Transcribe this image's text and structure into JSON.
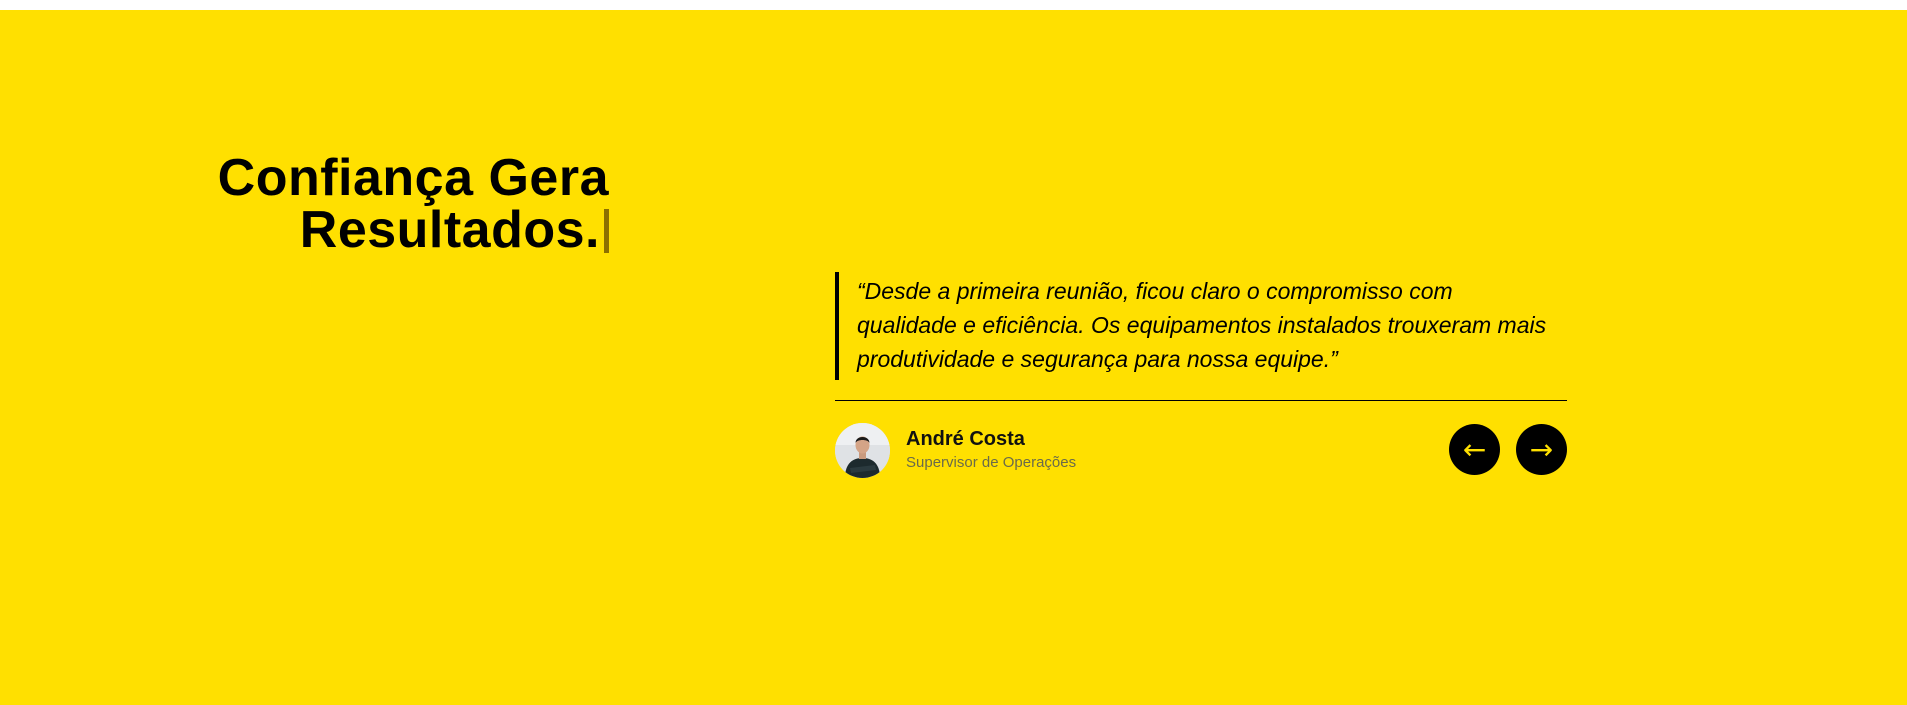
{
  "section": {
    "background_color": "#ffe000",
    "accent_text_color": "#000000"
  },
  "heading": {
    "line1": "Confiança Gera",
    "line2": "Resultados."
  },
  "testimonial": {
    "quote": "“Desde a primeira reunião, ficou claro o compromisso com qualidade e eficiência. Os equipamentos instalados trouxeram mais produtividade e segurança para nossa equipe.”",
    "author_name": "André Costa",
    "author_role": "Supervisor de Operações",
    "avatar_icon": "person-photo"
  },
  "navigation": {
    "prev_label": "←",
    "next_label": "→",
    "prev_icon": "arrow-left-icon",
    "next_icon": "arrow-right-icon"
  }
}
